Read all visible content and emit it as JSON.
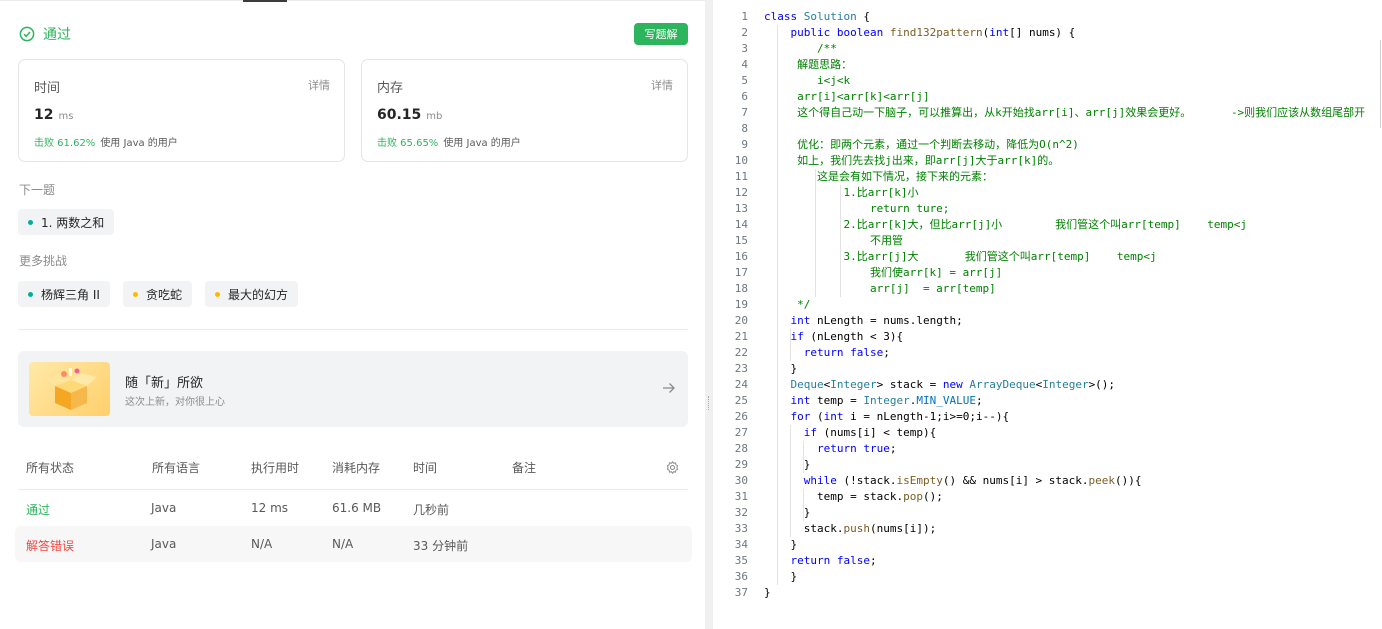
{
  "result": {
    "status_text": "通过",
    "write_solution_label": "写题解",
    "runtime": {
      "label": "时间",
      "detail": "详情",
      "value": "12",
      "unit": "ms",
      "beat_pct": "击败 61.62%",
      "beat_text": "使用 Java 的用户"
    },
    "memory": {
      "label": "内存",
      "detail": "详情",
      "value": "60.15",
      "unit": "mb",
      "beat_pct": "击败 65.65%",
      "beat_text": "使用 Java 的用户"
    }
  },
  "next": {
    "label": "下一题",
    "problem": "1. 两数之和"
  },
  "more": {
    "label": "更多挑战",
    "items": [
      {
        "text": "杨辉三角 II",
        "color": "#00af9b"
      },
      {
        "text": "贪吃蛇",
        "color": "#ffb800"
      },
      {
        "text": "最大的幻方",
        "color": "#ffb800"
      }
    ]
  },
  "banner": {
    "title": "随「新」所欲",
    "subtitle": "这次上新，对你很上心"
  },
  "submissions": {
    "headers": {
      "status": "所有状态",
      "language": "所有语言",
      "runtime": "执行用时",
      "memory": "消耗内存",
      "time": "时间",
      "note": "备注"
    },
    "rows": [
      {
        "status": "通过",
        "language": "Java",
        "runtime": "12 ms",
        "memory": "61.6 MB",
        "time": "几秒前"
      },
      {
        "status": "解答错误",
        "language": "Java",
        "runtime": "N/A",
        "memory": "N/A",
        "time": "33 分钟前"
      }
    ]
  },
  "code": {
    "lines": [
      "class Solution {",
      "    public boolean find132pattern(int[] nums) {",
      "        /**",
      "     解题思路：",
      "        i<j<k",
      "     arr[i]<arr[k]<arr[j]",
      "     这个得自己动一下脑子，可以推算出，从k开始找arr[i]、arr[j]效果会更好。      ->则我们应该从数组尾部开",
      "",
      "     优化：即两个元素，通过一个判断去移动，降低为O(n^2)",
      "     如上，我们先去找j出来，即arr[j]大于arr[k]的。",
      "        这是会有如下情况，接下来的元素：",
      "            1.比arr[k]小",
      "                return ture;",
      "            2.比arr[k]大，但比arr[j]小        我们管这个叫arr[temp]    temp<j",
      "                不用管",
      "            3.比arr[j]大       我们管这个叫arr[temp]    temp<j",
      "                我们使arr[k] = arr[j]",
      "                arr[j]  = arr[temp]",
      "     */",
      "    int nLength = nums.length;",
      "    if (nLength < 3){",
      "      return false;",
      "    }",
      "    Deque<Integer> stack = new ArrayDeque<Integer>();",
      "    int temp = Integer.MIN_VALUE;",
      "    for (int i = nLength-1;i>=0;i--){",
      "      if (nums[i] < temp){",
      "        return true;",
      "      }",
      "      while (!stack.isEmpty() && nums[i] > stack.peek()){",
      "        temp = stack.pop();",
      "      }",
      "      stack.push(nums[i]);",
      "    }",
      "    return false;",
      "    }",
      "}"
    ]
  }
}
